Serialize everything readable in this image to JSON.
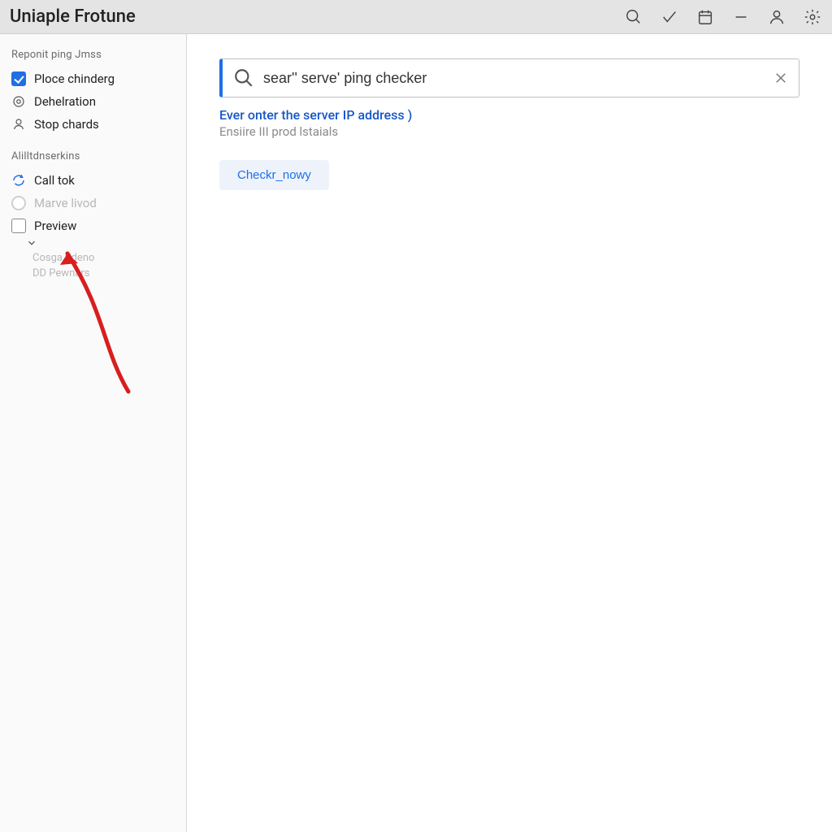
{
  "app": {
    "title": "Uniaple Frotune"
  },
  "sidebar": {
    "section1_title": "Reponit ping Jmss",
    "items1": [
      {
        "label": "Ploce chinderg"
      },
      {
        "label": "Dehelration"
      },
      {
        "label": "Stop chards"
      }
    ],
    "section2_title": "Alilltdnserkins",
    "items2": [
      {
        "label": "Call tok"
      },
      {
        "label": "Marve livod"
      },
      {
        "label": "Preview"
      }
    ],
    "subitems": [
      {
        "label": "Cosga  tideno"
      },
      {
        "label": "DD Pewnars"
      }
    ]
  },
  "search": {
    "value": "sear'' serve' ping checker",
    "hint_primary": "Ever onter the server IP address )",
    "hint_secondary": "Ensiire III prod lstaials"
  },
  "actions": {
    "check_label": "Checkr_nowy"
  }
}
